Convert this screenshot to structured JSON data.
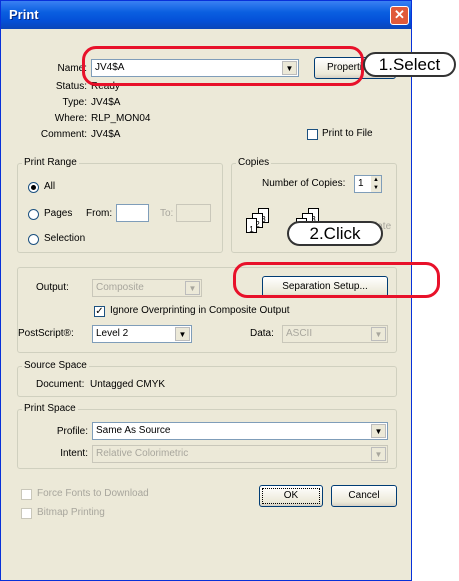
{
  "window": {
    "title": "Print",
    "close_glyph": "✕"
  },
  "printer": {
    "name_label": "Name:",
    "name_value": "JV4$A",
    "properties_label": "Properti",
    "status_label": "Status:",
    "status_value": "Ready",
    "type_label": "Type:",
    "type_value": "JV4$A",
    "where_label": "Where:",
    "where_value": "RLP_MON04",
    "comment_label": "Comment:",
    "comment_value": "JV4$A",
    "print_to_file_label": "Print to File"
  },
  "print_range": {
    "title": "Print Range",
    "all_label": "All",
    "pages_label": "Pages",
    "from_label": "From:",
    "to_label": "To:",
    "selection_label": "Selection",
    "selected": "All"
  },
  "copies": {
    "title": "Copies",
    "number_label": "Number of Copies:",
    "number_value": "1",
    "collate_label": "Collate",
    "page_numbers": [
      "1",
      "2",
      "3",
      "1",
      "2",
      "3"
    ]
  },
  "output": {
    "output_label": "Output:",
    "output_value": "Composite",
    "separation_setup_label": "Separation Setup...",
    "ignore_overprinting_label": "Ignore Overprinting in Composite Output",
    "ignore_overprinting_checked": true,
    "postscript_label": "PostScript®:",
    "postscript_value": "Level 2",
    "data_label": "Data:",
    "data_value": "ASCII"
  },
  "source_space": {
    "title": "Source Space",
    "document_label": "Document:",
    "document_value": "Untagged CMYK"
  },
  "print_space": {
    "title": "Print Space",
    "profile_label": "Profile:",
    "profile_value": "Same As Source",
    "intent_label": "Intent:",
    "intent_value": "Relative Colorimetric"
  },
  "footer": {
    "force_fonts_label": "Force Fonts to Download",
    "bitmap_printing_label": "Bitmap Printing",
    "ok_label": "OK",
    "cancel_label": "Cancel"
  },
  "annotations": {
    "step1": "1.Select",
    "step2": "2.Click",
    "color": "#e8112a"
  }
}
